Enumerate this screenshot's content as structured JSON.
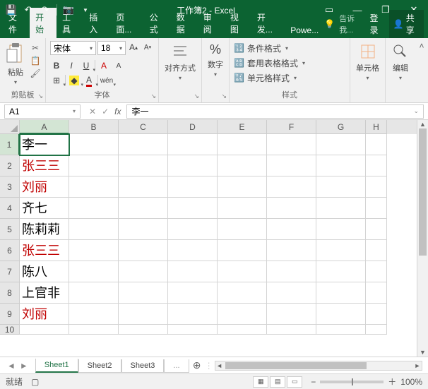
{
  "window": {
    "title": "工作簿2 - Excel"
  },
  "qat": {
    "save": "save-icon",
    "undo": "undo-icon",
    "redo": "redo-icon",
    "camera": "camera-icon"
  },
  "tabs": {
    "items": [
      "文件",
      "开始",
      "工具",
      "插入",
      "页面...",
      "公式",
      "数据",
      "审阅",
      "视图",
      "开发...",
      "Powe..."
    ],
    "active_index": 1,
    "tell_me": "告诉我...",
    "login": "登录",
    "share": "共享"
  },
  "ribbon": {
    "clipboard": {
      "paste": "粘贴",
      "label": "剪贴板"
    },
    "font": {
      "name": "宋体",
      "size": "18",
      "label": "字体"
    },
    "alignment": {
      "button": "对齐方式"
    },
    "number": {
      "button": "数字",
      "symbol": "%"
    },
    "styles": {
      "conditional": "条件格式",
      "table": "套用表格格式",
      "cell": "单元格样式",
      "label": "样式"
    },
    "cells": {
      "button": "单元格"
    },
    "editing": {
      "button": "编辑"
    }
  },
  "namebox": {
    "ref": "A1"
  },
  "formula": {
    "value": "李一"
  },
  "columns": [
    "A",
    "B",
    "C",
    "D",
    "E",
    "F",
    "G",
    "H"
  ],
  "rows": [
    {
      "n": "1",
      "a": "李一",
      "red": false
    },
    {
      "n": "2",
      "a": "张三三",
      "red": true
    },
    {
      "n": "3",
      "a": "刘丽",
      "red": true
    },
    {
      "n": "4",
      "a": "齐七",
      "red": false
    },
    {
      "n": "5",
      "a": "陈莉莉",
      "red": false
    },
    {
      "n": "6",
      "a": "张三三",
      "red": true
    },
    {
      "n": "7",
      "a": "陈八",
      "red": false
    },
    {
      "n": "8",
      "a": "上官非",
      "red": false
    },
    {
      "n": "9",
      "a": "刘丽",
      "red": true
    }
  ],
  "sheets": {
    "items": [
      "Sheet1",
      "Sheet2",
      "Sheet3"
    ],
    "more": "...",
    "active_index": 0
  },
  "status": {
    "ready": "就绪",
    "zoom": "100%"
  }
}
